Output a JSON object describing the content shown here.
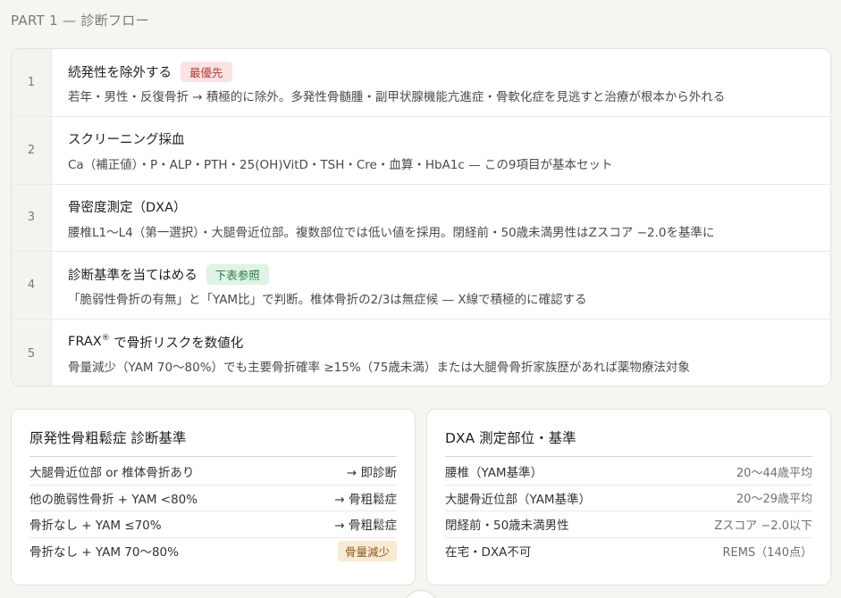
{
  "section_title": "PART 1 — 診断フロー",
  "steps": [
    {
      "num": "1",
      "title": "続発性を除外する",
      "badge": "最優先",
      "desc": "若年・男性・反復骨折 → 積極的に除外。多発性骨髄腫・副甲状腺機能亢進症・骨軟化症を見逃すと治療が根本から外れる"
    },
    {
      "num": "2",
      "title": "スクリーニング採血",
      "desc": "Ca（補正値）・P・ALP・PTH・25(OH)VitD・TSH・Cre・血算・HbA1c — この9項目が基本セット"
    },
    {
      "num": "3",
      "title": "骨密度測定（DXA）",
      "desc": "腰椎L1〜L4（第一選択）・大腿骨近位部。複数部位では低い値を採用。閉経前・50歳未満男性はZスコア −2.0を基準に"
    },
    {
      "num": "4",
      "title": "診断基準を当てはめる",
      "badge": "下表参照",
      "desc": "「脆弱性骨折の有無」と「YAM比」で判断。椎体骨折の2/3は無症候 — X線で積極的に確認する"
    },
    {
      "num": "5",
      "title": "FRAX",
      "title_sup": "®",
      "title_suffix": " で骨折リスクを数値化",
      "desc": "骨量減少（YAM 70〜80%）でも主要骨折確率 ≥15%（75歳未満）または大腿骨骨折家族歴があれば薬物療法対象"
    }
  ],
  "criteria": {
    "title": "原発性骨粗鬆症 診断基準",
    "rows": [
      {
        "label": "大腿骨近位部 or 椎体骨折あり",
        "value": "→ 即診断"
      },
      {
        "label": "他の脆弱性骨折 + YAM <80%",
        "value": "→ 骨粗鬆症"
      },
      {
        "label": "骨折なし + YAM ≤70%",
        "value": "→ 骨粗鬆症"
      },
      {
        "label": "骨折なし + YAM 70〜80%",
        "badge": "骨量減少"
      }
    ]
  },
  "dxa": {
    "title": "DXA 測定部位・基準",
    "rows": [
      {
        "label": "腰椎（YAM基準）",
        "value": "20〜44歳平均"
      },
      {
        "label": "大腿骨近位部（YAM基準）",
        "value": "20〜29歳平均"
      },
      {
        "label": "閉経前・50歳未満男性",
        "value": "Zスコア −2.0以下"
      },
      {
        "label": "在宅・DXA不可",
        "value": "REMS（140点）"
      }
    ]
  }
}
